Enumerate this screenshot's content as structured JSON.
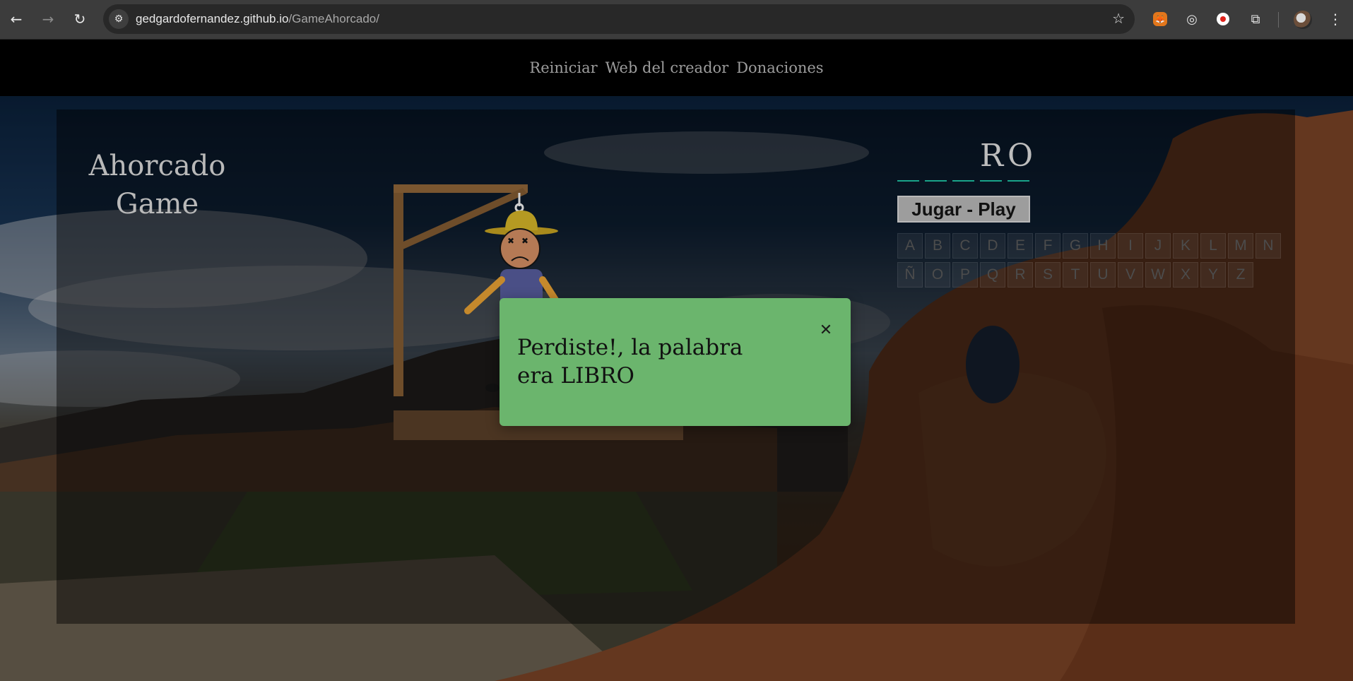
{
  "browser": {
    "url_domain": "gedgardofernandez.github.io",
    "url_path": "/GameAhorcado/",
    "back_icon": "←",
    "forward_icon": "→",
    "reload_icon": "↻",
    "site_info_icon": "⚙",
    "bookmark_icon": "☆",
    "extensions_icon": "⧉",
    "target_icon": "◎",
    "menu_icon": "⋮",
    "fox_icon": "🦊"
  },
  "topnav": {
    "items": [
      "Reiniciar",
      "Web del creador",
      "Donaciones"
    ]
  },
  "game": {
    "title_line1": "Ahorcado",
    "title_line2": "Game",
    "word_slots": [
      "",
      "",
      "",
      "R",
      "O"
    ],
    "play_button": "Jugar - Play",
    "keyboard_row1": [
      "A",
      "B",
      "C",
      "D",
      "E",
      "F",
      "G",
      "H",
      "I",
      "J",
      "K",
      "L",
      "M",
      "N"
    ],
    "keyboard_row2": [
      "Ñ",
      "O",
      "P",
      "Q",
      "R",
      "S",
      "T",
      "U",
      "V",
      "W",
      "X",
      "Y",
      "Z"
    ]
  },
  "modal": {
    "message": "Perdiste!, la palabra era LIBRO",
    "close_icon": "✕"
  },
  "colors": {
    "modal_bg": "#6bb56d",
    "slot_underline": "#1aa38a"
  }
}
